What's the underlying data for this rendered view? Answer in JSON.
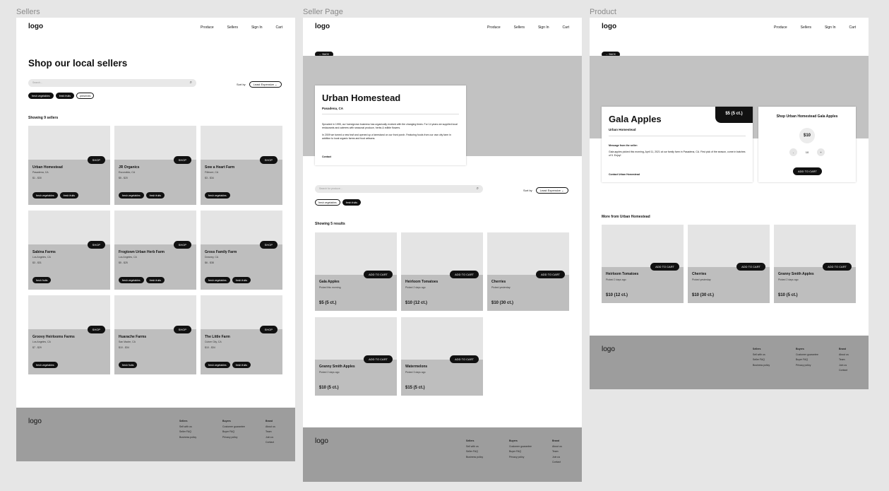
{
  "frames": {
    "sellers": "Sellers",
    "seller_page": "Seller Page",
    "product": "Product"
  },
  "nav": {
    "logo": "logo",
    "produce": "Produce",
    "sellers": "Sellers",
    "sign_in": "Sign In",
    "cart": "Cart"
  },
  "sellers_page": {
    "title": "Shop our local sellers",
    "search_placeholder": "Search...",
    "sort_label": "Sort by",
    "sort_value": "Least Expensive",
    "filters": [
      "fresh vegetables",
      "fresh fruits",
      "preserves"
    ],
    "showing": "Showing 9 sellers",
    "shop_label": "SHOP",
    "cards": [
      {
        "name": "Urban Homestead",
        "loc": "Pasadena, CA",
        "price": "$1 - $30",
        "chips": [
          "fresh vegetables",
          "fresh fruits"
        ]
      },
      {
        "name": "JR Organics",
        "loc": "Escondido, CA",
        "price": "$5 - $20",
        "chips": [
          "fresh vegetables",
          "fresh fruits"
        ]
      },
      {
        "name": "Sow a Heart Farm",
        "loc": "Fillmore, CA",
        "price": "$3 - $34",
        "chips": [
          "fresh vegetables"
        ]
      },
      {
        "name": "Sabina Farms",
        "loc": "Los Angeles, CA",
        "price": "$3 - $31",
        "chips": [
          "fresh fruits"
        ]
      },
      {
        "name": "Frogtown Urban Herb Farm",
        "loc": "Los Angeles, CA",
        "price": "$5 - $25",
        "chips": [
          "fresh vegetables",
          "fresh fruits"
        ]
      },
      {
        "name": "Gross Family Farm",
        "loc": "Downey, CA",
        "price": "$6 - $38",
        "chips": [
          "fresh vegetables",
          "fresh fruits"
        ]
      },
      {
        "name": "Groovy Heirlooms Farms",
        "loc": "Los Angeles, CA",
        "price": "$7 - $29",
        "chips": [
          "fresh vegetables"
        ]
      },
      {
        "name": "Huarache Farms",
        "loc": "San Madre, CA",
        "price": "$10 - $34",
        "chips": [
          "fresh fruits"
        ]
      },
      {
        "name": "The Little Farm",
        "loc": "Culver City, CA",
        "price": "$10 - $34",
        "chips": [
          "fresh vegetables",
          "fresh fruits"
        ]
      }
    ]
  },
  "seller_page": {
    "back": "BACK",
    "name": "Urban Homestead",
    "loc": "Pasadena, CA",
    "desc1": "Sprouted in 1995, our homegrown business has organically evolved with the changing times. For 14 years we supplied local restaurants and caterers with seasonal produce, herbs & edible flowers.",
    "desc2": "In 2009 we turned a new leaf and opened up a farmstand on our front porch. Featuring foods from our own city farm in addition to local organic farms and food artisans.",
    "contact": "Contact",
    "search_placeholder": "Search for produce...",
    "sort_label": "Sort by",
    "sort_value": "Least Expensive",
    "filters": [
      "fresh vegetables",
      "fresh fruits"
    ],
    "showing": "Showing 5 results",
    "add_label": "ADD TO CART",
    "products": [
      {
        "name": "Gala Apples",
        "picked": "Picked this morning",
        "price": "$5 (5 ct.)"
      },
      {
        "name": "Heirloom Tomatoes",
        "picked": "Picked 2 days ago",
        "price": "$10 (12 ct.)"
      },
      {
        "name": "Cherries",
        "picked": "Picked yesterday",
        "price": "$10 (30 ct.)"
      },
      {
        "name": "Granny Smith Apples",
        "picked": "Picked 2 days ago",
        "price": "$10 (5 ct.)"
      },
      {
        "name": "Watermelons",
        "picked": "Picked 3 days ago",
        "price": "$15 (5 ct.)"
      }
    ]
  },
  "product_page": {
    "back": "BACK",
    "name": "Gala Apples",
    "seller": "Urban Homestead",
    "price_tag": "$5 (5 ct.)",
    "message_title": "Message from the seller:",
    "message": "Gala apples picked this morning, April 11, 2021 at our family farm in Pasadena, CA. First pick of the season, come in batches of 5. Enjoy!",
    "contact": "Contact Urban Homestead",
    "shop_title": "Shop Urban Homestead Gala Apples",
    "total": "$10",
    "minus": "-",
    "qty": "10",
    "plus": "+",
    "add_label": "ADD TO CART",
    "more_title": "More from Urban Homestead",
    "more": [
      {
        "name": "Heirloom Tomatoes",
        "picked": "Picked 2 days ago",
        "price": "$10 (12 ct.)"
      },
      {
        "name": "Cherries",
        "picked": "Picked yesterday",
        "price": "$10 (30 ct.)"
      },
      {
        "name": "Granny Smith Apples",
        "picked": "Picked 2 days ago",
        "price": "$10 (5 ct.)"
      }
    ]
  },
  "footer": {
    "logo": "logo",
    "col1": {
      "title": "Sellers",
      "items": [
        "Sell with us",
        "Seller FAQ",
        "Business policy"
      ]
    },
    "col2": {
      "title": "Buyers",
      "items": [
        "Customer guarantee",
        "Buyer FAQ",
        "Privacy policy"
      ]
    },
    "col3": {
      "title": "Brand",
      "items": [
        "About us",
        "Team",
        "Join us",
        "Contact"
      ]
    }
  }
}
